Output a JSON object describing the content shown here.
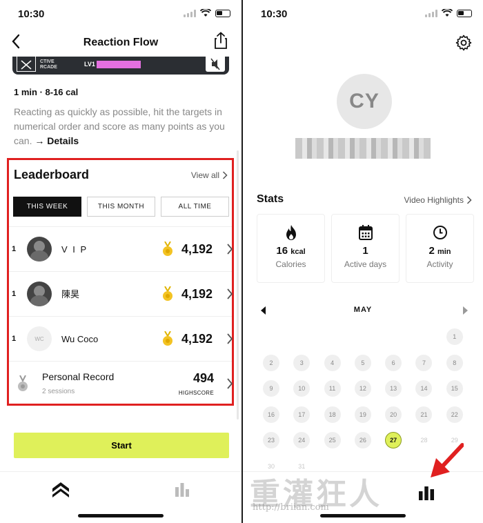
{
  "left": {
    "status": {
      "time": "10:30"
    },
    "title": "Reaction Flow",
    "preview": {
      "arcade": "CTIVE\nRCADE",
      "level": "LV1"
    },
    "meta": "1 min · 8-16 cal",
    "description": "Reacting as quickly as possible, hit the targets in numerical order and score as many points as you can.",
    "details_link": "→ Details",
    "leaderboard": {
      "title": "Leaderboard",
      "view_all": "View all",
      "tabs": [
        "THIS WEEK",
        "THIS MONTH",
        "ALL TIME"
      ],
      "active_tab": 0,
      "rows": [
        {
          "rank": "1",
          "name": "V I P",
          "score": "4,192"
        },
        {
          "rank": "1",
          "name": "陳昊",
          "score": "4,192"
        },
        {
          "rank": "1",
          "name": "Wu Coco",
          "score": "4,192",
          "avatar_text": "WC"
        }
      ],
      "personal": {
        "label": "Personal Record",
        "sessions": "2 sessions",
        "score": "494",
        "score_label": "HIGHSCORE"
      }
    },
    "start_label": "Start",
    "highlight_color": "#e02020",
    "accent_color": "#dff05a"
  },
  "right": {
    "status": {
      "time": "10:30"
    },
    "profile": {
      "initials": "CY"
    },
    "stats_title": "Stats",
    "video_highlights": "Video Highlights",
    "stats": [
      {
        "icon": "flame-icon",
        "value": "16",
        "unit": "kcal",
        "label": "Calories"
      },
      {
        "icon": "calendar-icon",
        "value": "1",
        "unit": "",
        "label": "Active days"
      },
      {
        "icon": "clock-icon",
        "value": "2",
        "unit": "min",
        "label": "Activity"
      }
    ],
    "calendar": {
      "month": "MAY",
      "days": [
        "",
        "",
        "",
        "",
        "",
        "",
        "1",
        "2",
        "3",
        "4",
        "5",
        "6",
        "7",
        "8",
        "9",
        "10",
        "11",
        "12",
        "13",
        "14",
        "15",
        "16",
        "17",
        "18",
        "19",
        "20",
        "21",
        "22",
        "23",
        "24",
        "25",
        "26",
        "27",
        "28",
        "29",
        "30",
        "31"
      ],
      "today": "27"
    },
    "watermark": "重灌狂人",
    "watermark_url": "http://briian.com"
  }
}
